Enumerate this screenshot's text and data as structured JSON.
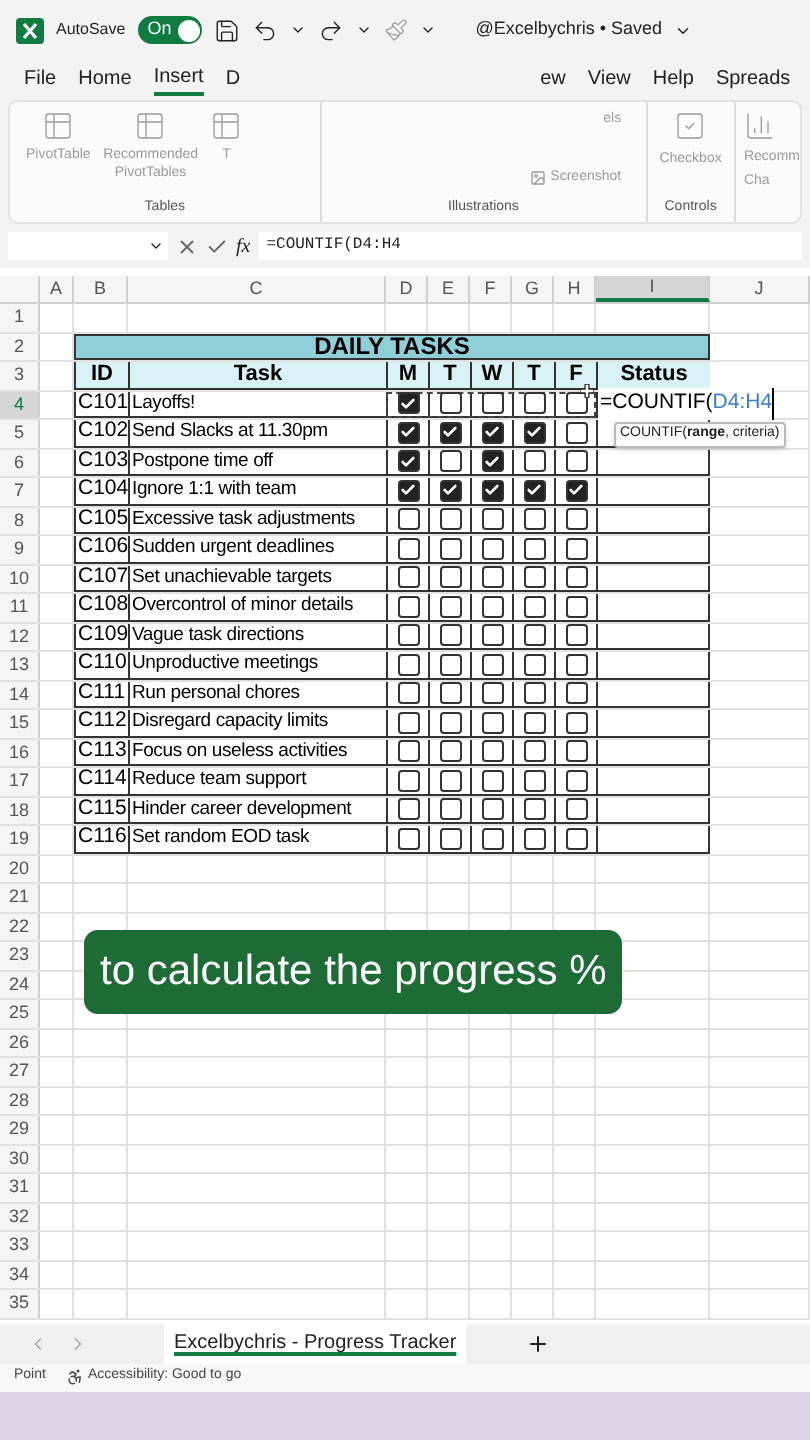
{
  "title_bar": {
    "autosave_label": "AutoSave",
    "autosave": {
      "on": true,
      "label": "On"
    },
    "doc_title": "@Excelbychris • Saved"
  },
  "menu_tabs": [
    {
      "label": "File",
      "selected": false
    },
    {
      "label": "Home",
      "selected": false
    },
    {
      "label": "Insert",
      "selected": true
    },
    {
      "label": "D",
      "selected": false
    },
    {
      "label": "ew",
      "selected": false
    },
    {
      "label": "View",
      "selected": false
    },
    {
      "label": "Help",
      "selected": false
    },
    {
      "label": "Spreads",
      "selected": false
    }
  ],
  "ribbon": {
    "tables": {
      "items": [
        "PivotTable",
        "Recommended PivotTables",
        "T"
      ],
      "label": "Tables"
    },
    "illustrations": {
      "items": [
        "els",
        "Screenshot"
      ],
      "label": "Illustrations"
    },
    "controls": {
      "items": [
        "Checkbox"
      ],
      "label": "Controls"
    },
    "cut_item": [
      "Recomm",
      "Cha"
    ]
  },
  "formula_bar": {
    "fx_label": "fx",
    "formula": "=COUNTIF(D4:H4"
  },
  "columns": [
    {
      "label": "A",
      "selected": false
    },
    {
      "label": "B",
      "selected": false
    },
    {
      "label": "C",
      "selected": false
    },
    {
      "label": "D",
      "selected": false
    },
    {
      "label": "E",
      "selected": false
    },
    {
      "label": "F",
      "selected": false
    },
    {
      "label": "G",
      "selected": false
    },
    {
      "label": "H",
      "selected": false
    },
    {
      "label": "I",
      "selected": true
    },
    {
      "label": "J",
      "selected": false
    }
  ],
  "rows": [
    {
      "num": "1",
      "kind": "empty",
      "selected": false
    },
    {
      "num": "2",
      "kind": "title",
      "selected": false,
      "title": "DAILY TASKS"
    },
    {
      "num": "3",
      "kind": "header",
      "selected": false,
      "cells": [
        "ID",
        "Task",
        "M",
        "T",
        "W",
        "T",
        "F",
        "Status"
      ]
    },
    {
      "num": "4",
      "kind": "task",
      "selected": true,
      "id": "C101",
      "task": "Layoffs!",
      "days": [
        true,
        false,
        false,
        false,
        false
      ],
      "status": {
        "text": "=COUNTIF(",
        "range": "D4:H4"
      }
    },
    {
      "num": "5",
      "kind": "task",
      "selected": false,
      "id": "C102",
      "task": "Send Slacks at 11.30pm",
      "days": [
        true,
        true,
        true,
        true,
        false
      ]
    },
    {
      "num": "6",
      "kind": "task",
      "selected": false,
      "id": "C103",
      "task": "Postpone time off",
      "days": [
        true,
        false,
        true,
        false,
        false
      ]
    },
    {
      "num": "7",
      "kind": "task",
      "selected": false,
      "id": "C104",
      "task": "Ignore 1:1 with team",
      "days": [
        true,
        true,
        true,
        true,
        true
      ]
    },
    {
      "num": "8",
      "kind": "task",
      "selected": false,
      "id": "C105",
      "task": "Excessive task adjustments",
      "days": [
        false,
        false,
        false,
        false,
        false
      ]
    },
    {
      "num": "9",
      "kind": "task",
      "selected": false,
      "id": "C106",
      "task": "Sudden urgent deadlines",
      "days": [
        false,
        false,
        false,
        false,
        false
      ]
    },
    {
      "num": "10",
      "kind": "task",
      "selected": false,
      "id": "C107",
      "task": "Set unachievable targets",
      "days": [
        false,
        false,
        false,
        false,
        false
      ]
    },
    {
      "num": "11",
      "kind": "task",
      "selected": false,
      "id": "C108",
      "task": "Overcontrol of minor details",
      "days": [
        false,
        false,
        false,
        false,
        false
      ]
    },
    {
      "num": "12",
      "kind": "task",
      "selected": false,
      "id": "C109",
      "task": "Vague task directions",
      "days": [
        false,
        false,
        false,
        false,
        false
      ]
    },
    {
      "num": "13",
      "kind": "task",
      "selected": false,
      "id": "C110",
      "task": "Unproductive meetings",
      "days": [
        false,
        false,
        false,
        false,
        false
      ]
    },
    {
      "num": "14",
      "kind": "task",
      "selected": false,
      "id": "C111",
      "task": "Run personal chores",
      "days": [
        false,
        false,
        false,
        false,
        false
      ]
    },
    {
      "num": "15",
      "kind": "task",
      "selected": false,
      "id": "C112",
      "task": "Disregard capacity limits",
      "days": [
        false,
        false,
        false,
        false,
        false
      ]
    },
    {
      "num": "16",
      "kind": "task",
      "selected": false,
      "id": "C113",
      "task": "Focus on useless activities",
      "days": [
        false,
        false,
        false,
        false,
        false
      ]
    },
    {
      "num": "17",
      "kind": "task",
      "selected": false,
      "id": "C114",
      "task": "Reduce team support",
      "days": [
        false,
        false,
        false,
        false,
        false
      ]
    },
    {
      "num": "18",
      "kind": "task",
      "selected": false,
      "id": "C115",
      "task": "Hinder career development",
      "days": [
        false,
        false,
        false,
        false,
        false
      ]
    },
    {
      "num": "19",
      "kind": "task",
      "selected": false,
      "id": "C116",
      "task": "Set random EOD task",
      "days": [
        false,
        false,
        false,
        false,
        false
      ]
    },
    {
      "num": "20",
      "kind": "empty",
      "selected": false
    },
    {
      "num": "21",
      "kind": "empty",
      "selected": false
    },
    {
      "num": "22",
      "kind": "empty",
      "selected": false
    },
    {
      "num": "23",
      "kind": "empty",
      "selected": false
    },
    {
      "num": "24",
      "kind": "empty",
      "selected": false
    },
    {
      "num": "25",
      "kind": "empty",
      "selected": false
    },
    {
      "num": "26",
      "kind": "empty",
      "selected": false
    },
    {
      "num": "27",
      "kind": "empty",
      "selected": false
    },
    {
      "num": "28",
      "kind": "empty",
      "selected": false
    },
    {
      "num": "29",
      "kind": "empty",
      "selected": false
    },
    {
      "num": "30",
      "kind": "empty",
      "selected": false
    },
    {
      "num": "31",
      "kind": "empty",
      "selected": false
    },
    {
      "num": "32",
      "kind": "empty",
      "selected": false
    },
    {
      "num": "33",
      "kind": "empty",
      "selected": false
    },
    {
      "num": "34",
      "kind": "empty",
      "selected": false
    },
    {
      "num": "35",
      "kind": "empty",
      "selected": false
    }
  ],
  "tooltip": "COUNTIF(**range**, criteria)",
  "caption": "to calculate the progress %",
  "sheet_tabs": [
    {
      "label": "Excelbychris - Progress Tracker",
      "selected": true
    }
  ],
  "status_bar": {
    "mode": "Point",
    "accessibility": "Accessibility: Good to go"
  }
}
